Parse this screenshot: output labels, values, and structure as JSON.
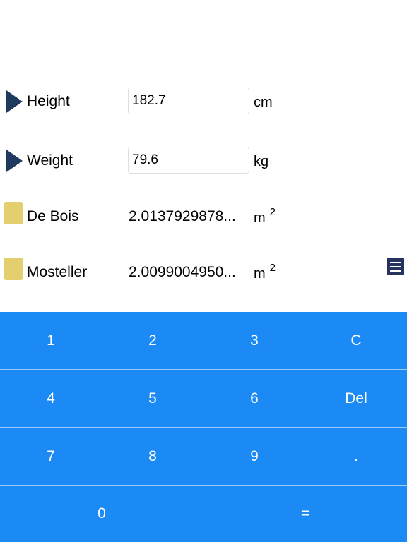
{
  "fields": {
    "height": {
      "label": "Height",
      "value": "182.7",
      "unit": "cm"
    },
    "weight": {
      "label": "Weight",
      "value": "79.6",
      "unit": "kg"
    }
  },
  "results": {
    "de_bois": {
      "label": "De Bois",
      "value": "2.0137929878...",
      "unit": "m",
      "exponent": "2"
    },
    "mosteller": {
      "label": "Mosteller",
      "value": "2.0099004950...",
      "unit": "m",
      "exponent": "2"
    }
  },
  "icons": {
    "input_marker": "play-triangle-icon",
    "result_marker": "yellow-square-icon",
    "menu": "hamburger-menu-icon"
  },
  "colors": {
    "keypad_background": "#1b8af5",
    "triangle": "#1f3a5f",
    "result_square": "#e3cf6e",
    "menu_button": "#25335e"
  },
  "keypad": {
    "row1": [
      "1",
      "2",
      "3",
      "C"
    ],
    "row2": [
      "4",
      "5",
      "6",
      "Del"
    ],
    "row3": [
      "7",
      "8",
      "9",
      "."
    ],
    "row4": [
      "0",
      "="
    ]
  }
}
